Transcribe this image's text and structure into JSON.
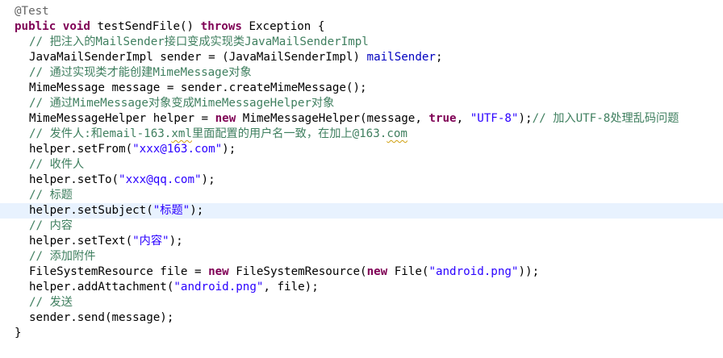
{
  "code": {
    "annotation": "@Test",
    "method_signature": {
      "kw_public": "public",
      "kw_void": "void",
      "name": "testSendFile()",
      "kw_throws": "throws",
      "rest": "Exception {"
    },
    "comment_cast": "// 把注入的MailSender接口变成实现类JavaMailSenderImpl",
    "sender_decl": "JavaMailSenderImpl sender = (JavaMailSenderImpl) ",
    "sender_field": "mailSender",
    "sender_end": ";",
    "comment_create": "// 通过实现类才能创建MimeMessage对象",
    "message_decl": "MimeMessage message = sender.createMimeMessage();",
    "comment_helper": "// 通过MimeMessage对象变成MimeMessageHelper对象",
    "helper_decl_a": "MimeMessageHelper helper = ",
    "helper_new": "new",
    "helper_decl_b": " MimeMessageHelper(message, ",
    "helper_true": "true",
    "helper_sep": ", ",
    "helper_charset": "\"UTF-8\"",
    "helper_end": ");",
    "comment_charset": "// 加入UTF-8处理乱码问题",
    "comment_from_a": "// 发件人:和email-163.",
    "comment_from_xml": "xml",
    "comment_from_b": "里面配置的用户名一致，在加上@163.",
    "comment_from_com": "com",
    "from_call": "helper.setFrom(",
    "from_value": "\"xxx@163.com\"",
    "from_end": ");",
    "comment_to": "// 收件人",
    "to_call": "helper.setTo(",
    "to_value": "\"xxx@qq.com\"",
    "to_end": ");",
    "comment_subject": "// 标题",
    "subject_call": "helper.setSubject(",
    "subject_value": "\"标题\"",
    "subject_end": ");",
    "comment_text": "// 内容",
    "text_call": "helper.setText(",
    "text_value": "\"内容\"",
    "text_end": ");",
    "comment_attach": "// 添加附件",
    "file_decl_a": "FileSystemResource file = ",
    "file_new1": "new",
    "file_decl_b": " FileSystemResource(",
    "file_new2": "new",
    "file_decl_c": " File(",
    "file_value": "\"android.png\"",
    "file_end": "));",
    "attach_call": "helper.addAttachment(",
    "attach_value": "\"android.png\"",
    "attach_end": ", file);",
    "comment_send": "// 发送",
    "send_call": "sender.send(message);",
    "close_brace": "}"
  },
  "colors": {
    "keyword": "#7f0055",
    "annotation": "#646464",
    "comment": "#3f7f5f",
    "string": "#2a00ff",
    "field": "#0000c0",
    "current_line": "#e8f2fe"
  }
}
